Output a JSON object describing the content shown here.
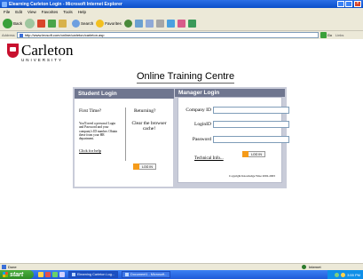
{
  "window": {
    "title": "Elearning Carleton Login - Microsoft Internet Explorer",
    "close_glyph": "×"
  },
  "menu": [
    "File",
    "Edit",
    "View",
    "Favorites",
    "Tools",
    "Help"
  ],
  "toolbar": {
    "back_label": "Back",
    "search_label": "Search",
    "favorites_label": "Favorites"
  },
  "address": {
    "label": "Address",
    "url": "http://www.lecsoft.com/online/carleton/carleton.asp",
    "go_label": "Go",
    "links_label": "Links"
  },
  "logo": {
    "name": "Carleton",
    "sub": "UNIVERSITY"
  },
  "page": {
    "heading": "Online Training Centre"
  },
  "student": {
    "heading": "Student Login",
    "first_time": "First Time?",
    "returning": "Returning?",
    "first_desc": "You'll need a personal Login and Password and your company's ID number. Obtain these from your HR department.",
    "click_help": "Click for help",
    "clear_cache": "Clear the browser cache!",
    "login_button": "LOG IN"
  },
  "manager": {
    "heading": "Manager Login",
    "company_id_label": "Company ID",
    "login_id_label": "LoginID",
    "password_label": "Password",
    "company_id_value": "",
    "login_id_value": "",
    "password_value": "",
    "technical_info": "Technical Info...",
    "login_button": "LOG IN",
    "copyright": "Copyright Knowledge Wise 2002-2003"
  },
  "statusbar": {
    "status": "Done",
    "zone": "Internet"
  },
  "taskbar": {
    "start": "start",
    "items": [
      "Elearning Carleton Log...",
      "Document1 - Microsoft..."
    ],
    "clock": "3:55 PM"
  },
  "colors": {
    "panel_bg": "#c9ccd9",
    "panel_header": "#6f768f",
    "login_arrow": "#f59b1a",
    "brand_red": "#c8102e"
  }
}
